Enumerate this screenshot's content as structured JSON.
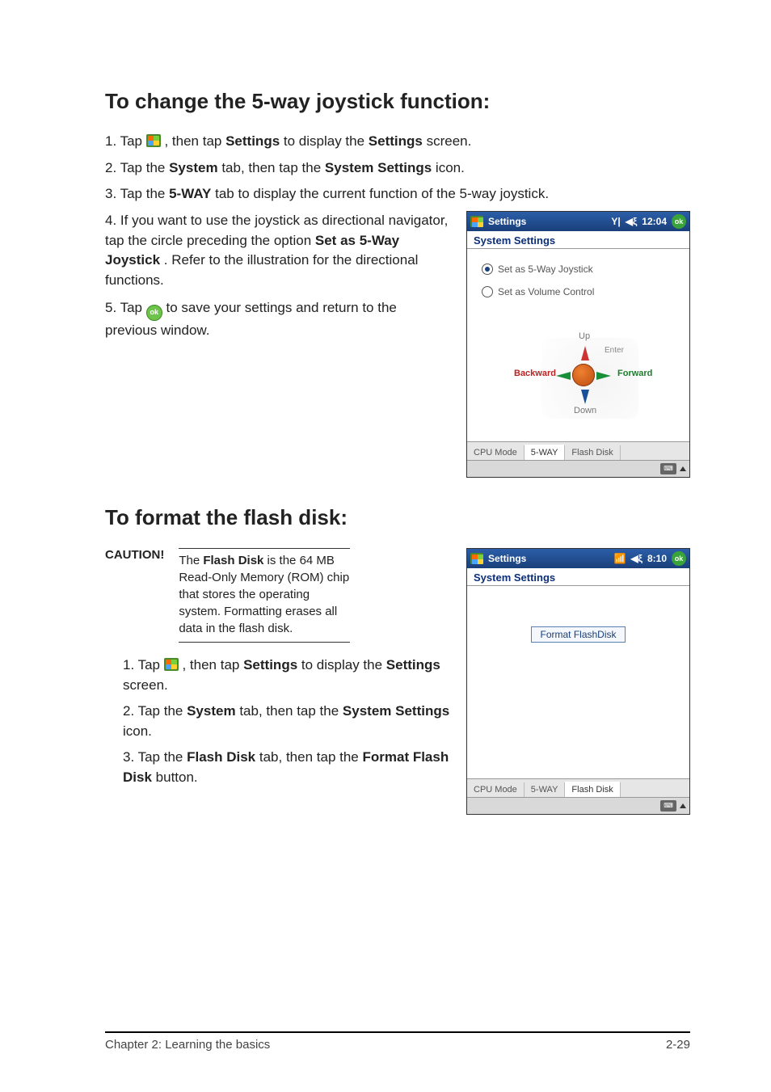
{
  "section1": {
    "heading": "To change the 5-way joystick function:",
    "steps": {
      "s1_a": "1. Tap ",
      "s1_b": ", then tap ",
      "s1_settings": "Settings",
      "s1_c": " to display the ",
      "s1_settings2": "Settings",
      "s1_d": " screen.",
      "s2_a": "2. Tap the ",
      "s2_system": "System",
      "s2_b": " tab, then tap the ",
      "s2_syssettings": "System Settings",
      "s2_c": " icon.",
      "s3_a": "3. Tap the ",
      "s3_fiveway": "5-WAY",
      "s3_b": " tab to display the current function of the 5-way joystick.",
      "s4_a": "4. If you want to use the joystick as directional navigator, tap the circle preceding the option ",
      "s4_opt": "Set as 5-Way Joystick",
      "s4_b": ". Refer to the illustration for the directional functions.",
      "s5_a": "5. Tap ",
      "s5_b": " to save your settings and return to the previous window."
    }
  },
  "section2": {
    "heading": "To format the flash disk:",
    "caution_label": "CAUTION!",
    "caution_text_a": "The ",
    "caution_flash": "Flash Disk",
    "caution_text_b": " is the 64 MB Read-Only Memory (ROM) chip that stores the operating system. Formatting erases all data in the flash disk.",
    "steps": {
      "s1_a": "1. Tap ",
      "s1_b": ", then tap ",
      "s1_settings": "Settings",
      "s1_c": " to display the ",
      "s1_settings2": "Settings",
      "s1_d": " screen.",
      "s2_a": "2. Tap the ",
      "s2_system": "System",
      "s2_b": " tab, then tap the ",
      "s2_syssettings": "System Settings",
      "s2_c": " icon.",
      "s3_a": "3. Tap the ",
      "s3_flash": "Flash Disk",
      "s3_b": " tab, then tap the ",
      "s3_format": "Format Flash Disk",
      "s3_c": " button."
    }
  },
  "wm1": {
    "title": "Settings",
    "signal": "Y|",
    "clock": "12:04",
    "ok": "ok",
    "header": "System Settings",
    "radio1": "Set as 5-Way Joystick",
    "radio2": "Set as Volume Control",
    "labels": {
      "up": "Up",
      "down": "Down",
      "enter": "Enter",
      "back": "Backward",
      "fwd": "Forward"
    },
    "tabs": {
      "t1": "CPU Mode",
      "t2": "5-WAY",
      "t3": "Flash Disk"
    }
  },
  "wm2": {
    "title": "Settings",
    "clock": "8:10",
    "ok": "ok",
    "header": "System Settings",
    "button": "Format FlashDisk",
    "tabs": {
      "t1": "CPU Mode",
      "t2": "5-WAY",
      "t3": "Flash Disk"
    }
  },
  "footer": {
    "left": "Chapter 2: Learning the basics",
    "right": "2-29"
  },
  "chart_data": null
}
